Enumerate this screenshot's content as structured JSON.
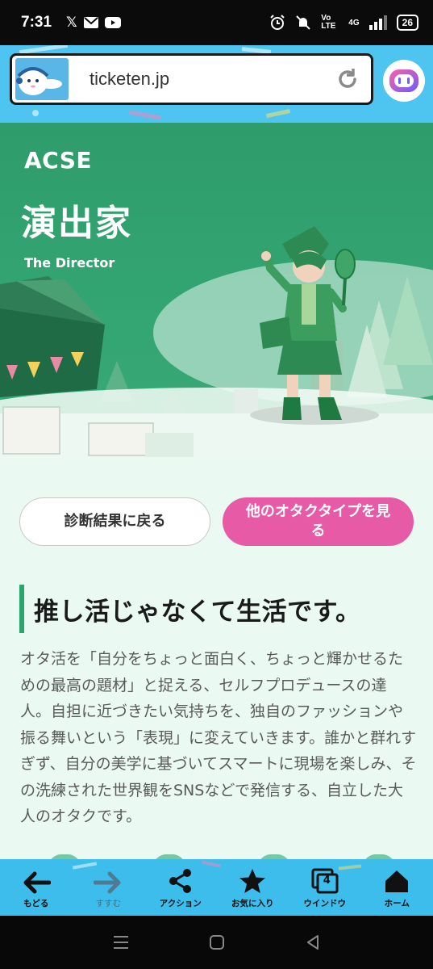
{
  "status_bar": {
    "time": "7:31",
    "network": "4G",
    "volte": "Vo LTE",
    "battery": "26"
  },
  "browser": {
    "url": "ticketen.jp",
    "reload_icon": "reload-icon",
    "ai_icon": "ai-assistant-icon"
  },
  "hero": {
    "type_code": "ACSE",
    "type_name": "演出家",
    "type_name_en": "The Director"
  },
  "actions": {
    "back_label": "診断結果に戻る",
    "other_types_label": "他のオタクタイプを見る"
  },
  "section": {
    "heading": "推し活じゃなくて生活です。",
    "description": "オタ活を「自分をちょっと面白く、ちょっと輝かせるための最高の題材」と捉える、セルフプロデュースの達人。自担に近づきたい気持ちを、独自のファッションや振る舞いという「表現」に変えていきます。誰かと群れすぎず、自分の美学に基づいてスマートに現場を楽しみ、その洗練された世界観をSNSなどで発信する、自立した大人のオタクです。"
  },
  "toolbar": {
    "items": [
      {
        "label": "もどる",
        "icon": "back-arrow-icon"
      },
      {
        "label": "すすむ",
        "icon": "forward-arrow-icon"
      },
      {
        "label": "アクション",
        "icon": "share-icon"
      },
      {
        "label": "お気に入り",
        "icon": "star-icon"
      },
      {
        "label": "ウインドウ",
        "icon": "window-icon",
        "count": "4"
      },
      {
        "label": "ホーム",
        "icon": "home-icon"
      }
    ]
  },
  "colors": {
    "header_blue": "#4ec5f0",
    "hero_green": "#2f9c6b",
    "accent_pink": "#e75aa6",
    "content_bg": "#eafaf3"
  }
}
